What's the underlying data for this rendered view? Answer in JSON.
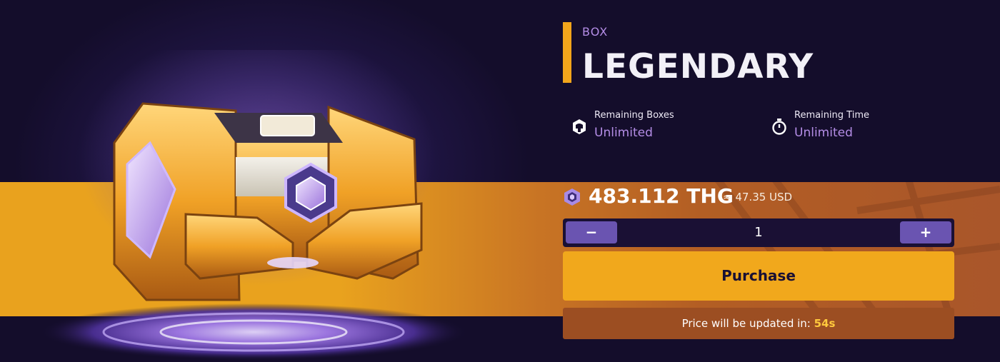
{
  "box": {
    "kicker": "BOX",
    "name": "LEGENDARY"
  },
  "stats": {
    "remaining_boxes": {
      "label": "Remaining Boxes",
      "value": "Unlimited",
      "icon": "box-helmet-icon"
    },
    "remaining_time": {
      "label": "Remaining Time",
      "value": "Unlimited",
      "icon": "stopwatch-icon"
    }
  },
  "price": {
    "amount": "483.112 THG",
    "usd": "≈ 47.35 USD",
    "icon": "thg-coin-icon"
  },
  "quantity": {
    "minus_label": "−",
    "value": "1",
    "plus_label": "+"
  },
  "purchase_label": "Purchase",
  "notice": {
    "text": "Price will be updated in: ",
    "countdown": "54s"
  },
  "colors": {
    "background": "#140d2b",
    "accent": "#f2a51b",
    "purple": "#b48de6",
    "button": "#6a54b1"
  }
}
